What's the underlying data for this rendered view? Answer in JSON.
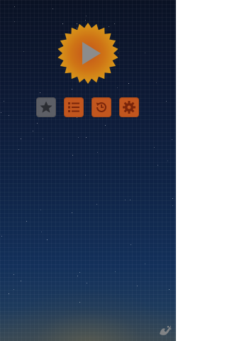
{
  "screen": {
    "title": "",
    "colors": {
      "sky_top": "#0a1224",
      "sky_bottom": "#1d3a5c",
      "sun_outer": "#d18a12",
      "sun_inner": "#c65a14",
      "play_triangle": "#8a8a8a",
      "button_gray": "#5d5f66",
      "button_orange": "#c2561e",
      "icon_fg": "#8f2e0c"
    }
  },
  "play_button": {
    "icon": "play-icon"
  },
  "menu": {
    "buttons": [
      {
        "id": "favorites",
        "icon": "star-icon"
      },
      {
        "id": "levels",
        "icon": "list-icon"
      },
      {
        "id": "restore",
        "icon": "history-icon"
      },
      {
        "id": "settings",
        "icon": "gear-icon"
      }
    ]
  },
  "corner_logo": {
    "icon": "splash-logo-icon"
  }
}
